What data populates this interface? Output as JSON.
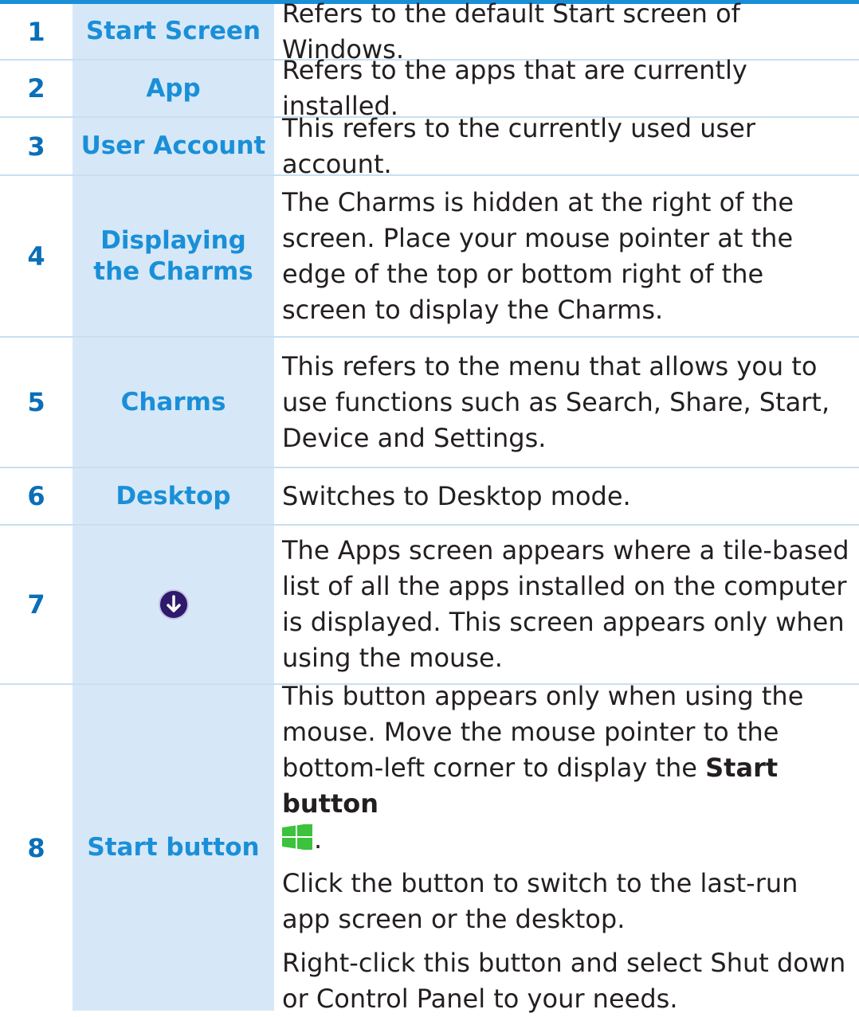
{
  "colors": {
    "accent": "#1a8fd8",
    "number": "#0a6fb8",
    "item_bg": "#d6e8f7",
    "text": "#231f20",
    "icon_bg": "#2e1a6b"
  },
  "rows": [
    {
      "num": "1",
      "item": "Start Screen",
      "desc": "Refers to the default Start screen of Windows."
    },
    {
      "num": "2",
      "item": "App",
      "desc": "Refers to the apps that are currently installed."
    },
    {
      "num": "3",
      "item": "User Account",
      "desc": "This refers to the currently used user account."
    },
    {
      "num": "4",
      "item": "Displaying the Charms",
      "desc": "The Charms is hidden at the right of the screen. Place your mouse pointer at the edge of the top or bottom right of the screen to display the Charms."
    },
    {
      "num": "5",
      "item": "Charms",
      "desc": "This refers to the menu that allows you to use functions such as Search, Share, Start, Device and Settings."
    },
    {
      "num": "6",
      "item": "Desktop",
      "desc": "Switches to Desktop mode."
    },
    {
      "num": "7",
      "item_icon": "down-arrow-circle-icon",
      "desc": "The Apps screen appears where a tile-based list of all the apps installed on the computer is displayed. This screen appears only when using the mouse."
    },
    {
      "num": "8",
      "item": "Start button",
      "desc_line1": "This button appears only when using the mouse. Move the mouse pointer to the bottom-left corner to display the ",
      "desc_bold": "Start button",
      "desc_icon": "windows-logo-icon",
      "desc_period": ".",
      "desc_para2": "Click the button to switch to the last-run app screen or the desktop.",
      "desc_para3": "Right-click this button and select Shut down or Control Panel to your needs."
    }
  ]
}
